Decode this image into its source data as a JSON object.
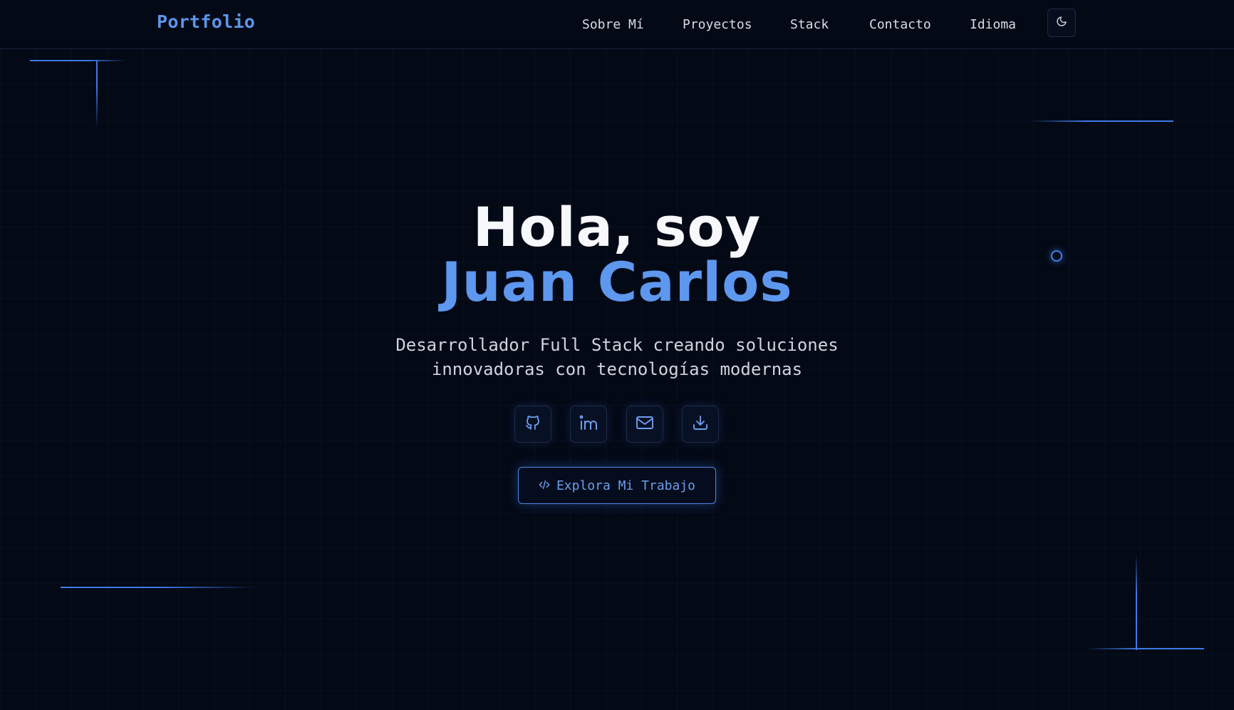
{
  "nav": {
    "brand": "Portfolio",
    "links": [
      "Sobre Mí",
      "Proyectos",
      "Stack",
      "Contacto",
      "Idioma"
    ],
    "theme_icon": "moon-icon"
  },
  "hero": {
    "greeting": "Hola, soy",
    "name": "Juan Carlos",
    "subtitle_line1": "Desarrollador Full Stack creando soluciones",
    "subtitle_line2": "innovadoras con tecnologías modernas",
    "social_icons": [
      "github-icon",
      "linkedin-icon",
      "mail-icon",
      "download-icon"
    ],
    "cta_label": "Explora Mi Trabajo",
    "cta_icon": "code-icon"
  },
  "colors": {
    "background": "#040916",
    "accent": "#5d95e8",
    "text": "#d9dce3",
    "heading": "#f7f8fb"
  }
}
